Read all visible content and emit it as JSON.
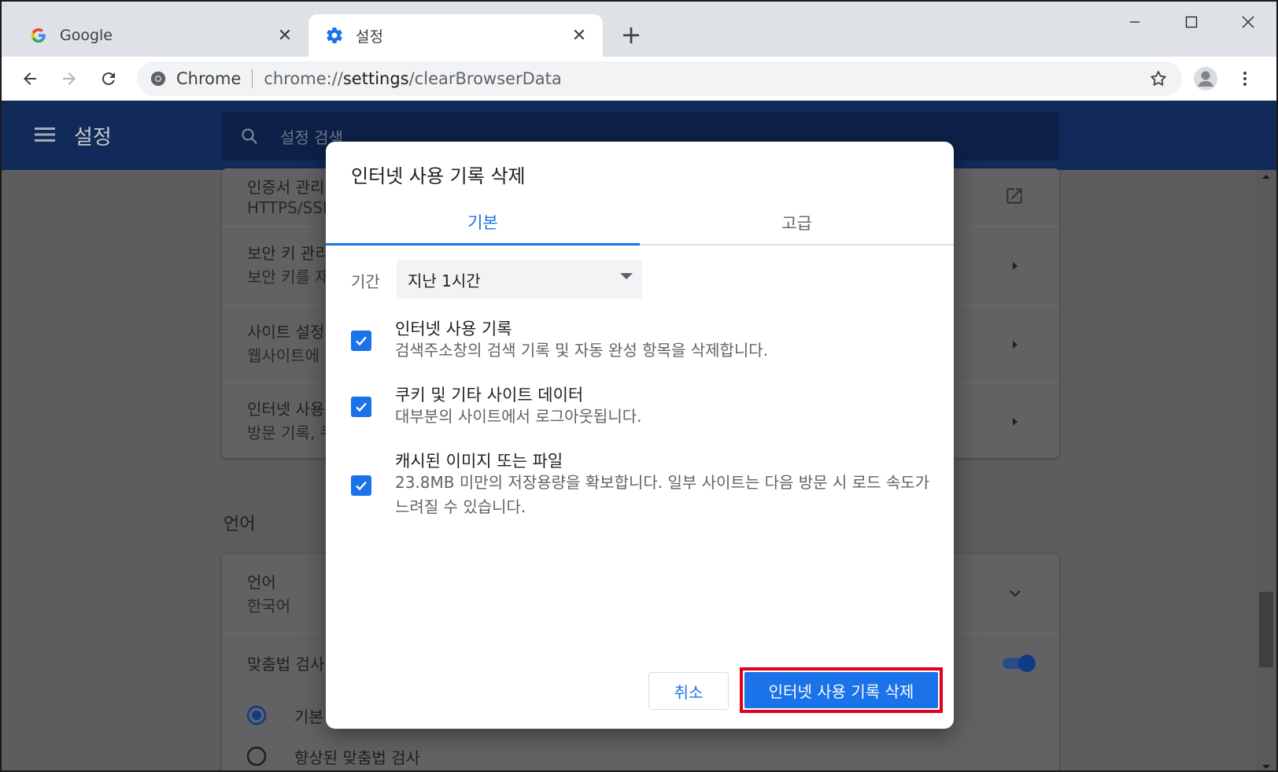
{
  "browser": {
    "tabs": [
      {
        "title": "Google",
        "icon": "google-g-icon"
      },
      {
        "title": "설정",
        "icon": "gear-icon"
      }
    ],
    "tab_close_glyph": "✕",
    "new_tab_glyph": "+",
    "omnibox": {
      "chip_label": "Chrome",
      "url_prefix": "chrome://",
      "url_host": "settings",
      "url_path": "/clearBrowserData"
    }
  },
  "settings": {
    "app_title": "설정",
    "search_placeholder": "설정 검색",
    "rows": [
      {
        "title": "인증서 관리",
        "subtitle": "HTTPS/SSL"
      },
      {
        "title": "보안 키 관리",
        "subtitle": "보안 키를 재"
      },
      {
        "title": "사이트 설정",
        "subtitle": "웹사이트에"
      },
      {
        "title": "인터넷 사용",
        "subtitle": "방문 기록, 쿠"
      }
    ],
    "language_section_title": "언어",
    "language_row": {
      "title": "언어",
      "subtitle": "한국어"
    },
    "spellcheck_label": "맞춤법 검사",
    "radio_basic": "기본",
    "radio_enhanced": "향상된 맞춤법 검사"
  },
  "dialog": {
    "title": "인터넷 사용 기록 삭제",
    "tabs": [
      "기본",
      "고급"
    ],
    "period_label": "기간",
    "period_value": "지난 1시간",
    "options": [
      {
        "title": "인터넷 사용 기록",
        "desc": "검색주소창의 검색 기록 및 자동 완성 항목을 삭제합니다.",
        "checked": true
      },
      {
        "title": "쿠키 및 기타 사이트 데이터",
        "desc": "대부분의 사이트에서 로그아웃됩니다.",
        "checked": true
      },
      {
        "title": "캐시된 이미지 또는 파일",
        "desc": "23.8MB 미만의 저장용량을 확보합니다. 일부 사이트는 다음 방문 시 로드 속도가 느려질 수 있습니다.",
        "checked": true
      }
    ],
    "cancel_label": "취소",
    "confirm_label": "인터넷 사용 기록 삭제"
  },
  "colors": {
    "accent": "#1a73e8",
    "highlight": "#e0001b",
    "appbar": "#112a5a"
  }
}
